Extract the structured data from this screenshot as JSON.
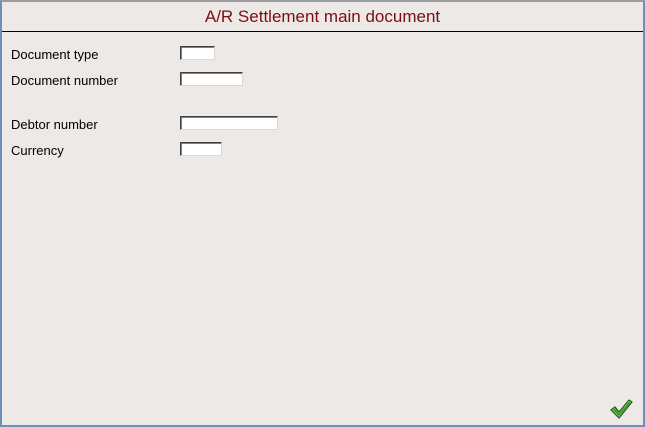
{
  "window": {
    "title": "A/R Settlement main document"
  },
  "form": {
    "fields": [
      {
        "label": "Document type",
        "value": ""
      },
      {
        "label": "Document number",
        "value": ""
      },
      {
        "label": "Debtor number",
        "value": ""
      },
      {
        "label": "Currency",
        "value": ""
      }
    ]
  },
  "actions": {
    "confirm_icon": "green-checkmark-icon"
  },
  "colors": {
    "title": "#7a0e12",
    "background": "#ece9e6",
    "checkmark": "#3c9b2b"
  }
}
